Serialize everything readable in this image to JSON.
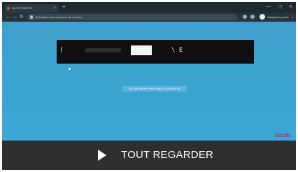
{
  "browser": {
    "tab_title": "BLOG D'IMROS",
    "address": "Actualisez pour récupérer du contenu",
    "profile_label": "Navigation privée"
  },
  "page": {
    "banner_left": "(",
    "banner_right": "\\ E",
    "notice": "Ne plus afficher cette page si possible fini",
    "logo": "Ecole"
  },
  "overlay": {
    "label": "TOUT REGARDER",
    "play_icon": "play-icon"
  },
  "colors": {
    "page_background": "#3aa3cf",
    "banner": "#0f0f12",
    "overlay_bar": "#2f2f31",
    "logo": "#c8295a"
  }
}
